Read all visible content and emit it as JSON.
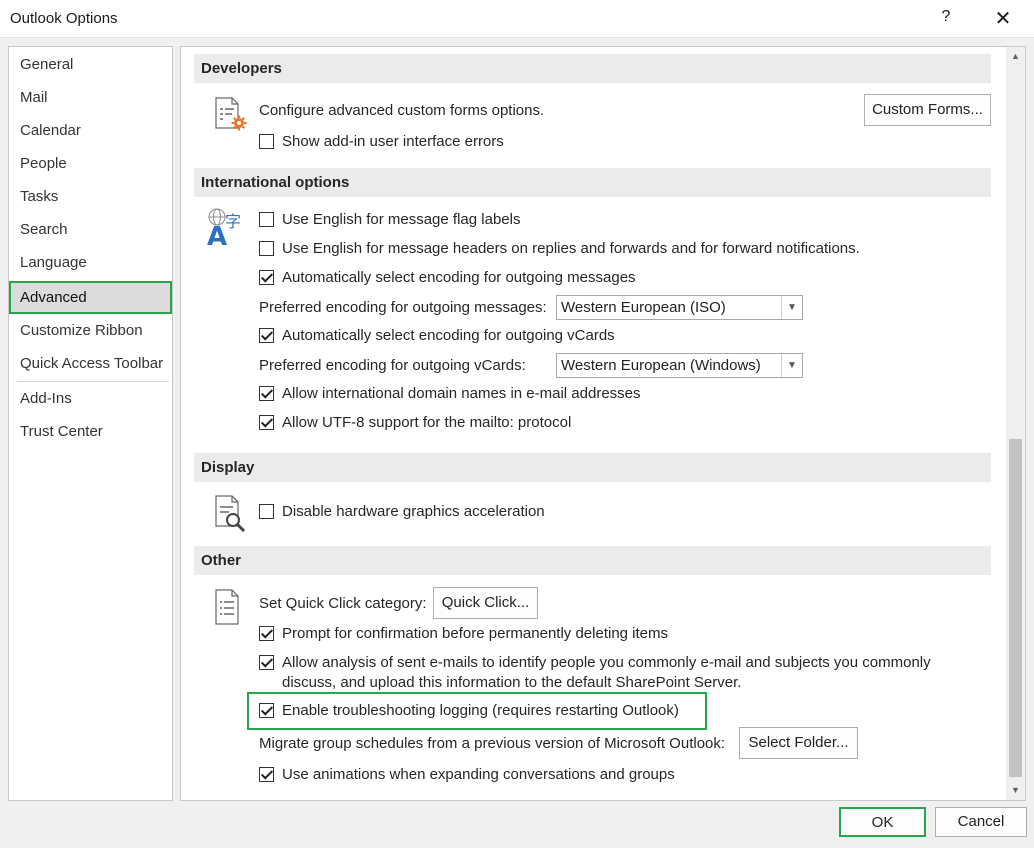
{
  "window": {
    "title": "Outlook Options",
    "help": "?",
    "close": "✕"
  },
  "nav": {
    "items": [
      {
        "label": "General"
      },
      {
        "label": "Mail"
      },
      {
        "label": "Calendar"
      },
      {
        "label": "People"
      },
      {
        "label": "Tasks"
      },
      {
        "label": "Search"
      },
      {
        "label": "Language"
      },
      {
        "label": "Advanced",
        "active": true
      },
      {
        "label": "Customize Ribbon"
      },
      {
        "label": "Quick Access Toolbar"
      },
      {
        "label": "Add-Ins"
      },
      {
        "label": "Trust Center"
      }
    ]
  },
  "developers": {
    "header": "Developers",
    "configure_label": "Configure advanced custom forms options.",
    "custom_forms_button": "Custom Forms...",
    "show_addin_errors": {
      "label": "Show add-in user interface errors",
      "checked": false
    }
  },
  "international": {
    "header": "International options",
    "flag_labels": {
      "label": "Use English for message flag labels",
      "checked": false
    },
    "message_headers": {
      "label": "Use English for message headers on replies and forwards and for forward notifications.",
      "checked": false
    },
    "auto_encoding_messages": {
      "label": "Automatically select encoding for outgoing messages",
      "checked": true
    },
    "pref_encoding_messages_label": "Preferred encoding for outgoing messages:",
    "pref_encoding_messages_value": "Western European (ISO)",
    "auto_encoding_vcards": {
      "label": "Automatically select encoding for outgoing vCards",
      "checked": true
    },
    "pref_encoding_vcards_label": "Preferred encoding for outgoing vCards:",
    "pref_encoding_vcards_value": "Western European (Windows)",
    "idn": {
      "label": "Allow international domain names in e-mail addresses",
      "checked": true
    },
    "utf8": {
      "label": "Allow UTF-8 support for the mailto: protocol",
      "checked": true
    }
  },
  "display": {
    "header": "Display",
    "hw_accel": {
      "label": "Disable hardware graphics acceleration",
      "checked": false
    }
  },
  "other": {
    "header": "Other",
    "quick_click_label": "Set Quick Click category:",
    "quick_click_button": "Quick Click...",
    "confirm_delete": {
      "label": "Prompt for confirmation before permanently deleting items",
      "checked": true
    },
    "analysis": {
      "label_line1": "Allow analysis of sent e-mails to identify people you commonly e-mail and subjects you commonly",
      "label_line2": "discuss, and upload this information to the default SharePoint Server.",
      "checked": true
    },
    "troubleshooting": {
      "label": "Enable troubleshooting logging (requires restarting Outlook)",
      "checked": true
    },
    "migrate_label": "Migrate group schedules from a previous version of Microsoft Outlook:",
    "select_folder_button": "Select Folder...",
    "animations": {
      "label": "Use animations when expanding conversations and groups",
      "checked": true
    }
  },
  "footer": {
    "ok": "OK",
    "cancel": "Cancel"
  },
  "colors": {
    "highlight": "#22a84a",
    "icon_blue": "#2b72c4",
    "icon_orange": "#e8772e"
  }
}
